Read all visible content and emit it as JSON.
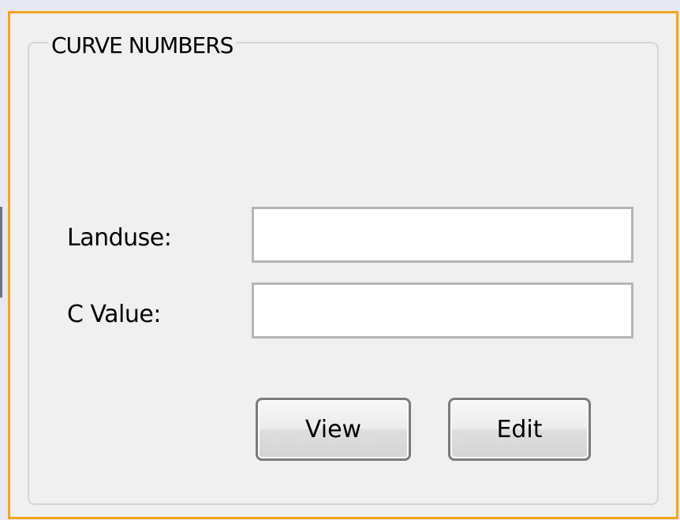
{
  "group": {
    "title": "CURVE NUMBERS"
  },
  "fields": {
    "landuse": {
      "label": "Landuse:",
      "value": ""
    },
    "c_value": {
      "label": "C Value:",
      "value": ""
    }
  },
  "buttons": {
    "view": "View",
    "edit": "Edit"
  },
  "colors": {
    "panel_border": "#f2a51e",
    "panel_background": "#f0f0f0",
    "window_background": "#e8e8f3"
  }
}
